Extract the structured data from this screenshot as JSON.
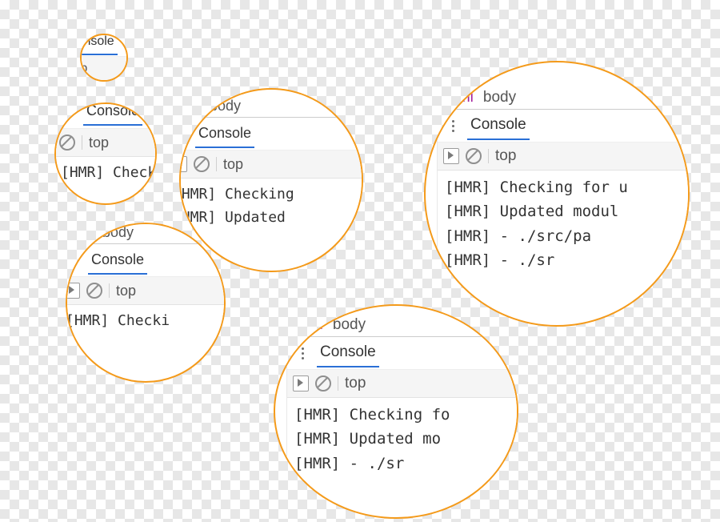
{
  "devtools": {
    "breadcrumbs": {
      "html": "html",
      "body": "body"
    },
    "tab": {
      "console": "Console"
    },
    "toolbar": {
      "context": "top"
    },
    "log_lines": {
      "l0": "[HMR] Checking for u",
      "l1": "[HMR] Updated modul",
      "l2": "[HMR]  - ./src/pa",
      "l3": "[HMR]  - ./sr"
    },
    "log_medium": {
      "l0": "[HMR] Checking fo",
      "l1": "[HMR] Updated mo",
      "l2": "[HMR]  - ./sr"
    },
    "log_short": {
      "l0": "[HMR] Checking",
      "l1": "[HMR] Updated"
    },
    "log_tiny": {
      "l0": "[HMR] Checki"
    }
  },
  "lens_ring_color": "#f49a1a"
}
